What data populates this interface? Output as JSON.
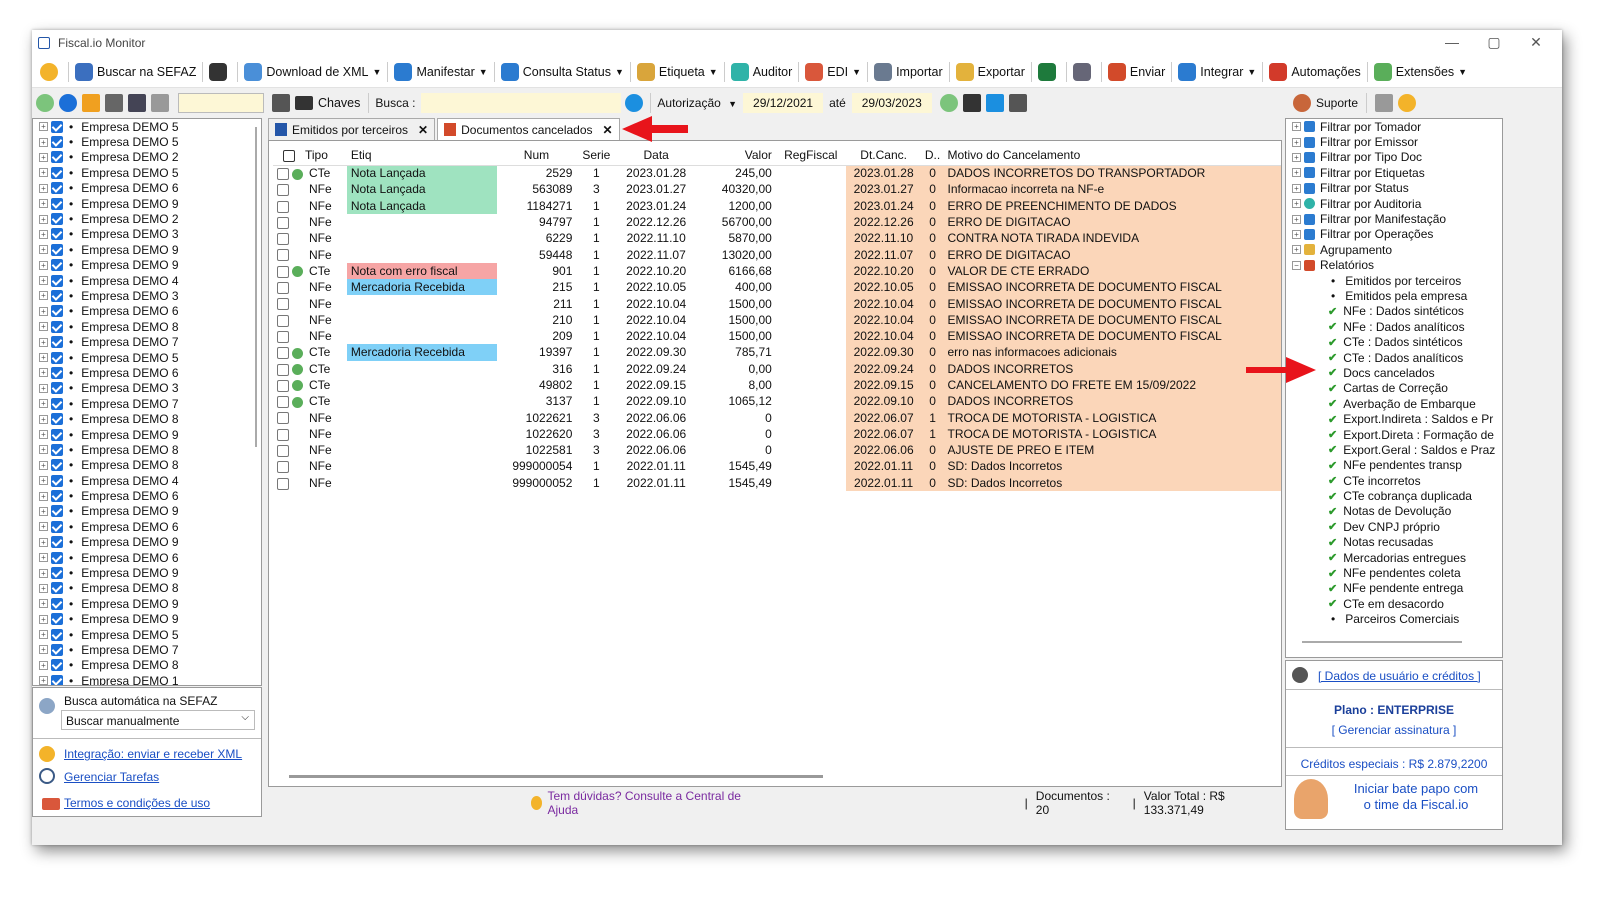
{
  "window": {
    "title": "Fiscal.io Monitor"
  },
  "menu": [
    {
      "label": "Buscar na SEFAZ",
      "icon": "globe-icon"
    },
    {
      "label": "",
      "icon": "list-icon"
    },
    {
      "label": "Download de XML",
      "icon": "xml-icon",
      "dropdown": true
    },
    {
      "label": "Manifestar",
      "icon": "manifest-icon",
      "dropdown": true
    },
    {
      "label": "Consulta Status",
      "icon": "check-circle-icon",
      "dropdown": true
    },
    {
      "label": "Etiqueta",
      "icon": "tag-icon",
      "dropdown": true
    },
    {
      "label": "Auditor",
      "icon": "auditor-icon"
    },
    {
      "label": "EDI",
      "icon": "truck-icon",
      "dropdown": true
    },
    {
      "label": "Importar",
      "icon": "import-icon"
    },
    {
      "label": "Exportar",
      "icon": "export-icon"
    },
    {
      "label": "",
      "icon": "excel-icon"
    },
    {
      "label": "",
      "icon": "printer-icon"
    },
    {
      "label": "Enviar",
      "icon": "mail-icon"
    },
    {
      "label": "Integrar",
      "icon": "integrate-icon",
      "dropdown": true
    },
    {
      "label": "Automações",
      "icon": "automation-icon"
    },
    {
      "label": "Extensões",
      "icon": "extension-icon",
      "dropdown": true
    }
  ],
  "toolbar": {
    "chaves": "Chaves",
    "busca_label": "Busca :",
    "autorizacao": "Autorização",
    "date_from": "29/12/2021",
    "ate": "até",
    "date_to": "29/03/2023",
    "suporte": "Suporte"
  },
  "companies": [
    "Empresa DEMO 5",
    "Empresa DEMO 5",
    "Empresa DEMO 2",
    "Empresa DEMO 5",
    "Empresa DEMO 6",
    "Empresa DEMO 9",
    "Empresa DEMO 2",
    "Empresa DEMO 3",
    "Empresa DEMO 9",
    "Empresa DEMO 9",
    "Empresa DEMO 4",
    "Empresa DEMO 3",
    "Empresa DEMO 6",
    "Empresa DEMO 8",
    "Empresa DEMO 7",
    "Empresa DEMO 5",
    "Empresa DEMO 6",
    "Empresa DEMO 3",
    "Empresa DEMO 7",
    "Empresa DEMO 8",
    "Empresa DEMO 9",
    "Empresa DEMO 8",
    "Empresa DEMO 8",
    "Empresa DEMO 4",
    "Empresa DEMO 6",
    "Empresa DEMO 9",
    "Empresa DEMO 6",
    "Empresa DEMO 9",
    "Empresa DEMO 6",
    "Empresa DEMO 9",
    "Empresa DEMO 8",
    "Empresa DEMO 9",
    "Empresa DEMO 9",
    "Empresa DEMO 5",
    "Empresa DEMO 7",
    "Empresa DEMO 8",
    "Empresa DEMO 1"
  ],
  "auto": {
    "label": "Busca automática na SEFAZ",
    "select": "Buscar manualmente",
    "integ": "Integração: enviar e receber XML",
    "tarefas": "Gerenciar Tarefas",
    "termos": "Termos e condições de uso"
  },
  "tabs": [
    {
      "label": "Emitidos por terceiros"
    },
    {
      "label": "Documentos cancelados"
    }
  ],
  "columns": [
    "Tipo",
    "Etiq",
    "Num",
    "Serie",
    "Data",
    "Valor",
    "RegFiscal",
    "Dt.Canc.",
    "D..",
    "Motivo do Cancelamento"
  ],
  "rows": [
    {
      "tipo": "CTe",
      "etiq": "Nota Lançada",
      "etiq_color": "#9fe3c0",
      "num": "2529",
      "serie": "1",
      "data": "2023.01.28",
      "valor": "245,00",
      "dtcanc": "2023.01.28",
      "d": "0",
      "motivo": "DADOS INCORRETOS DO TRANSPORTADOR"
    },
    {
      "tipo": "NFe",
      "etiq": "Nota Lançada",
      "etiq_color": "#9fe3c0",
      "num": "563089",
      "serie": "3",
      "data": "2023.01.27",
      "valor": "40320,00",
      "dtcanc": "2023.01.27",
      "d": "0",
      "motivo": "Informacao incorreta na NF-e"
    },
    {
      "tipo": "NFe",
      "etiq": "Nota Lançada",
      "etiq_color": "#9fe3c0",
      "num": "1184271",
      "serie": "1",
      "data": "2023.01.24",
      "valor": "1200,00",
      "dtcanc": "2023.01.24",
      "d": "0",
      "motivo": "ERRO DE PREENCHIMENTO DE DADOS"
    },
    {
      "tipo": "NFe",
      "etiq": "",
      "etiq_color": "",
      "num": "94797",
      "serie": "1",
      "data": "2022.12.26",
      "valor": "56700,00",
      "dtcanc": "2022.12.26",
      "d": "0",
      "motivo": "ERRO DE DIGITACAO"
    },
    {
      "tipo": "NFe",
      "etiq": "",
      "etiq_color": "",
      "num": "6229",
      "serie": "1",
      "data": "2022.11.10",
      "valor": "5870,00",
      "dtcanc": "2022.11.10",
      "d": "0",
      "motivo": "CONTRA NOTA TIRADA INDEVIDA"
    },
    {
      "tipo": "NFe",
      "etiq": "",
      "etiq_color": "",
      "num": "59448",
      "serie": "1",
      "data": "2022.11.07",
      "valor": "13020,00",
      "dtcanc": "2022.11.07",
      "d": "0",
      "motivo": "ERRO DE DIGITACAO"
    },
    {
      "tipo": "CTe",
      "etiq": "Nota com erro fiscal",
      "etiq_color": "#f6a5a5",
      "num": "901",
      "serie": "1",
      "data": "2022.10.20",
      "valor": "6166,68",
      "dtcanc": "2022.10.20",
      "d": "0",
      "motivo": "VALOR DE CTE ERRADO"
    },
    {
      "tipo": "NFe",
      "etiq": "Mercadoria Recebida",
      "etiq_color": "#7fd0f7",
      "num": "215",
      "serie": "1",
      "data": "2022.10.05",
      "valor": "400,00",
      "dtcanc": "2022.10.05",
      "d": "0",
      "motivo": "EMISSAO INCORRETA DE DOCUMENTO FISCAL"
    },
    {
      "tipo": "NFe",
      "etiq": "",
      "etiq_color": "",
      "num": "211",
      "serie": "1",
      "data": "2022.10.04",
      "valor": "1500,00",
      "dtcanc": "2022.10.04",
      "d": "0",
      "motivo": "EMISSAO INCORRETA DE DOCUMENTO FISCAL"
    },
    {
      "tipo": "NFe",
      "etiq": "",
      "etiq_color": "",
      "num": "210",
      "serie": "1",
      "data": "2022.10.04",
      "valor": "1500,00",
      "dtcanc": "2022.10.04",
      "d": "0",
      "motivo": "EMISSAO INCORRETA DE DOCUMENTO FISCAL"
    },
    {
      "tipo": "NFe",
      "etiq": "",
      "etiq_color": "",
      "num": "209",
      "serie": "1",
      "data": "2022.10.04",
      "valor": "1500,00",
      "dtcanc": "2022.10.04",
      "d": "0",
      "motivo": "EMISSAO INCORRETA DE DOCUMENTO FISCAL"
    },
    {
      "tipo": "CTe",
      "etiq": "Mercadoria Recebida",
      "etiq_color": "#7fd0f7",
      "num": "19397",
      "serie": "1",
      "data": "2022.09.30",
      "valor": "785,71",
      "dtcanc": "2022.09.30",
      "d": "0",
      "motivo": "erro nas informacoes adicionais"
    },
    {
      "tipo": "CTe",
      "etiq": "",
      "etiq_color": "",
      "num": "316",
      "serie": "1",
      "data": "2022.09.24",
      "valor": "0,00",
      "dtcanc": "2022.09.24",
      "d": "0",
      "motivo": "DADOS INCORRETOS"
    },
    {
      "tipo": "CTe",
      "etiq": "",
      "etiq_color": "",
      "num": "49802",
      "serie": "1",
      "data": "2022.09.15",
      "valor": "8,00",
      "dtcanc": "2022.09.15",
      "d": "0",
      "motivo": "CANCELAMENTO DO FRETE EM 15/09/2022"
    },
    {
      "tipo": "CTe",
      "etiq": "",
      "etiq_color": "",
      "num": "3137",
      "serie": "1",
      "data": "2022.09.10",
      "valor": "1065,12",
      "dtcanc": "2022.09.10",
      "d": "0",
      "motivo": "DADOS INCORRETOS"
    },
    {
      "tipo": "NFe",
      "etiq": "",
      "etiq_color": "",
      "num": "1022621",
      "serie": "3",
      "data": "2022.06.06",
      "valor": "0",
      "dtcanc": "2022.06.07",
      "d": "1",
      "motivo": "TROCA DE MOTORISTA - LOGISTICA"
    },
    {
      "tipo": "NFe",
      "etiq": "",
      "etiq_color": "",
      "num": "1022620",
      "serie": "3",
      "data": "2022.06.06",
      "valor": "0",
      "dtcanc": "2022.06.07",
      "d": "1",
      "motivo": "TROCA DE MOTORISTA - LOGISTICA"
    },
    {
      "tipo": "NFe",
      "etiq": "",
      "etiq_color": "",
      "num": "1022581",
      "serie": "3",
      "data": "2022.06.06",
      "valor": "0",
      "dtcanc": "2022.06.06",
      "d": "0",
      "motivo": "AJUSTE DE PREO E ITEM"
    },
    {
      "tipo": "NFe",
      "etiq": "",
      "etiq_color": "",
      "num": "999000054",
      "serie": "1",
      "data": "2022.01.11",
      "valor": "1545,49",
      "dtcanc": "2022.01.11",
      "d": "0",
      "motivo": "SD: Dados Incorretos"
    },
    {
      "tipo": "NFe",
      "etiq": "",
      "etiq_color": "",
      "num": "999000052",
      "serie": "1",
      "data": "2022.01.11",
      "valor": "1545,49",
      "dtcanc": "2022.01.11",
      "d": "0",
      "motivo": "SD: Dados Incorretos"
    }
  ],
  "filters": [
    {
      "label": "Filtrar por Tomador",
      "kind": "filter"
    },
    {
      "label": "Filtrar por Emissor",
      "kind": "filter"
    },
    {
      "label": "Filtrar por Tipo Doc",
      "kind": "filter"
    },
    {
      "label": "Filtrar por Etiquetas",
      "kind": "filter"
    },
    {
      "label": "Filtrar por Status",
      "kind": "filter"
    },
    {
      "label": "Filtrar por Auditoria",
      "kind": "audit"
    },
    {
      "label": "Filtrar por Manifestação",
      "kind": "filter"
    },
    {
      "label": "Filtrar por Operações",
      "kind": "filter"
    },
    {
      "label": "Agrupamento",
      "kind": "group"
    },
    {
      "label": "Relatórios",
      "kind": "report"
    }
  ],
  "reports": [
    {
      "label": "Emitidos por terceiros",
      "mark": "dot"
    },
    {
      "label": "Emitidos pela empresa",
      "mark": "dot"
    },
    {
      "label": "NFe : Dados sintéticos",
      "mark": "tick"
    },
    {
      "label": "NFe : Dados analíticos",
      "mark": "tick"
    },
    {
      "label": "CTe : Dados sintéticos",
      "mark": "tick"
    },
    {
      "label": "CTe : Dados analíticos",
      "mark": "tick"
    },
    {
      "label": "Docs cancelados",
      "mark": "tick"
    },
    {
      "label": "Cartas de Correção",
      "mark": "tick"
    },
    {
      "label": "Averbação de Embarque",
      "mark": "tick"
    },
    {
      "label": "Export.Indireta : Saldos e Pr",
      "mark": "tick"
    },
    {
      "label": "Export.Direta : Formação de",
      "mark": "tick"
    },
    {
      "label": "Export.Geral : Saldos e Praz",
      "mark": "tick"
    },
    {
      "label": "NFe pendentes transp",
      "mark": "tick"
    },
    {
      "label": "CTe incorretos",
      "mark": "tick"
    },
    {
      "label": "CTe cobrança duplicada",
      "mark": "tick"
    },
    {
      "label": "Notas de Devolução",
      "mark": "tick"
    },
    {
      "label": "Dev CNPJ próprio",
      "mark": "tick"
    },
    {
      "label": "Notas recusadas",
      "mark": "tick"
    },
    {
      "label": "Mercadorias entregues",
      "mark": "tick"
    },
    {
      "label": "NFe pendentes coleta",
      "mark": "tick"
    },
    {
      "label": "NFe pendente entrega",
      "mark": "tick"
    },
    {
      "label": "CTe em desacordo",
      "mark": "tick"
    },
    {
      "label": "Parceiros Comerciais",
      "mark": "dot"
    }
  ],
  "account": {
    "dados": "[ Dados de usuário e créditos ]",
    "plano": "Plano : ENTERPRISE",
    "gerenciar": "[ Gerenciar assinatura ]",
    "creditos": "Créditos especiais : R$ 2.879,2200",
    "chat1": "Iniciar bate papo com",
    "chat2": "o time da Fiscal.io"
  },
  "status": {
    "help": "Tem dúvidas? Consulte a Central de Ajuda",
    "docs": "Documentos : 20",
    "total": "Valor Total : R$ 133.371,49"
  },
  "colors": {
    "peach": "#fbd6b9",
    "arrow": "#e8141b",
    "link": "#1a4fc4"
  }
}
